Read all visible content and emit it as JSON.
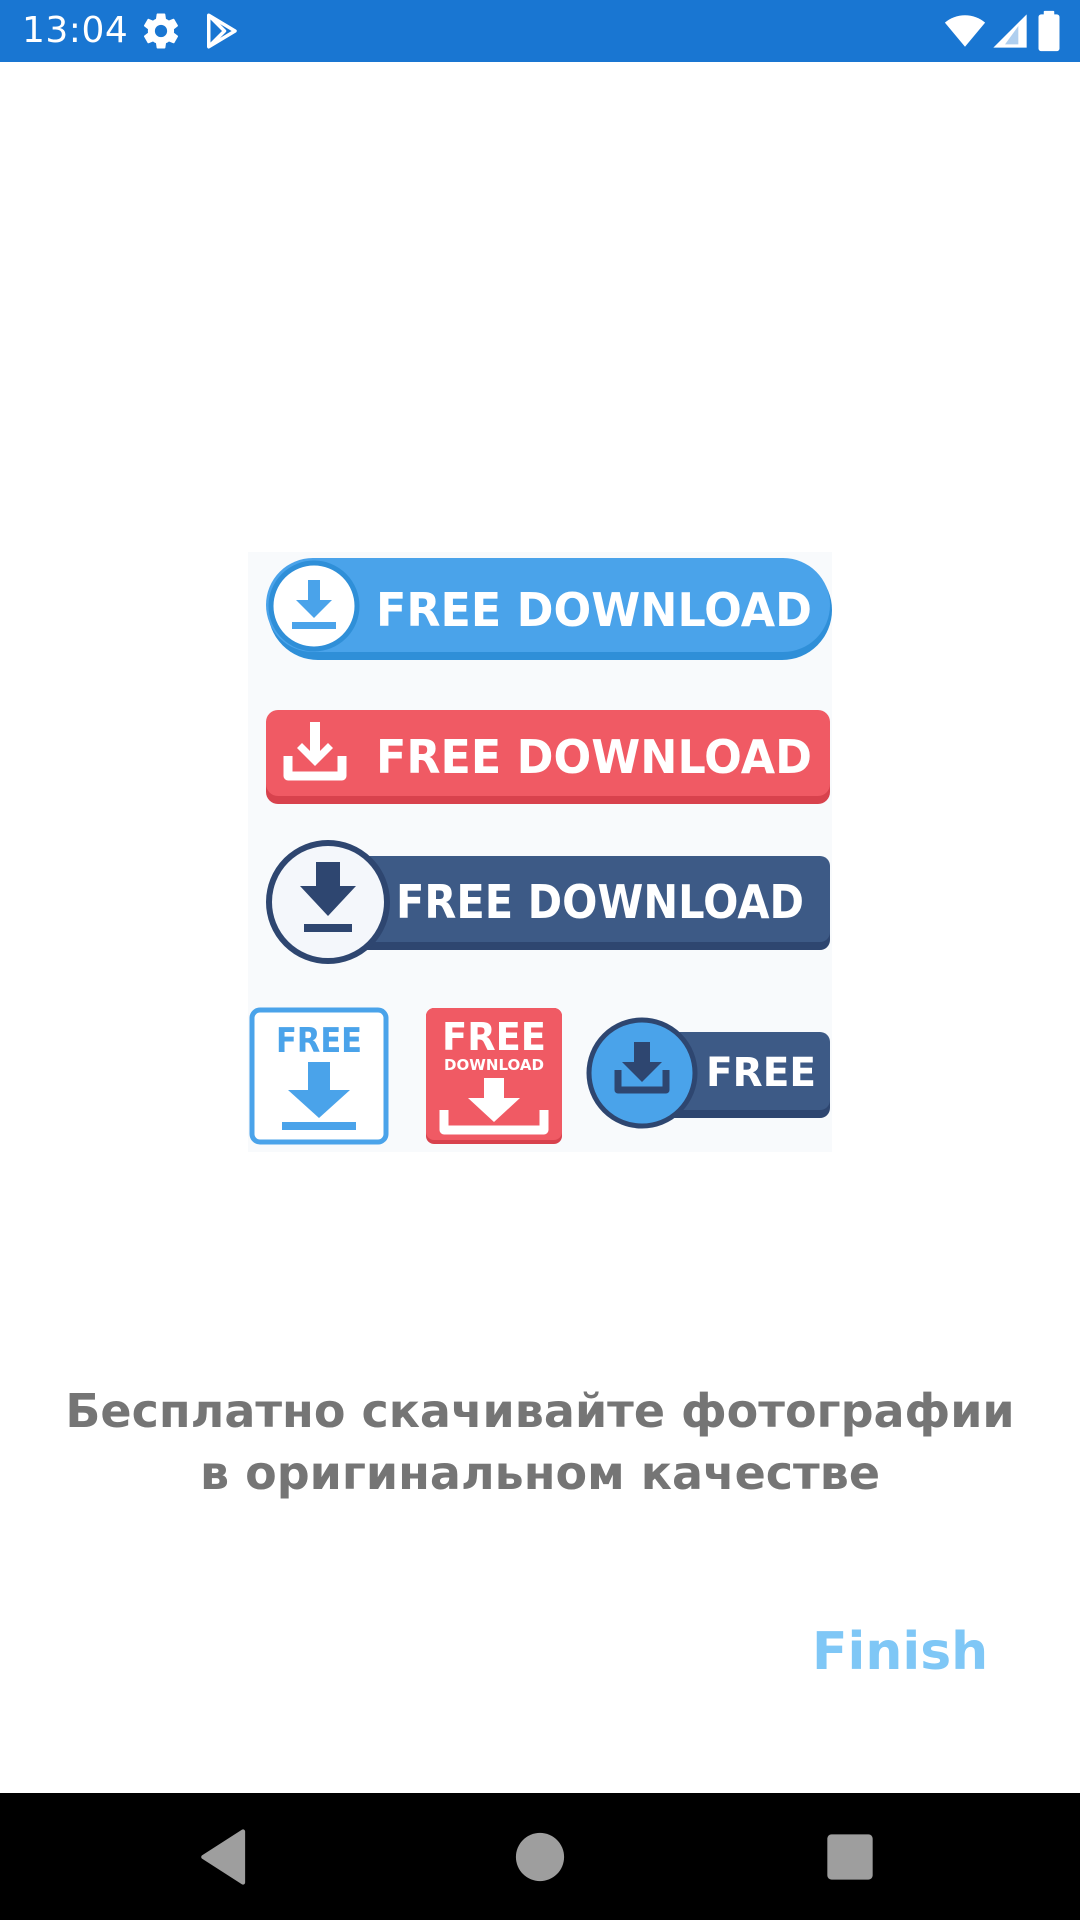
{
  "status_bar": {
    "time": "13:04",
    "background_color": "#1976d2",
    "icons": [
      "settings-icon",
      "play-store-icon",
      "wifi-icon",
      "signal-icon",
      "battery-icon"
    ]
  },
  "illustration": {
    "buttons": [
      {
        "label": "FREE DOWNLOAD",
        "color": "#4aa3ea",
        "style": "round-pill-with-circle-icon"
      },
      {
        "label": "FREE DOWNLOAD",
        "color": "#f05a64",
        "style": "flat-rectangle-with-tray-icon"
      },
      {
        "label": "FREE DOWNLOAD",
        "color": "#3d5a86",
        "style": "rectangle-with-outlined-circle-icon"
      }
    ],
    "badges": [
      {
        "label": "FREE",
        "color": "#4aa3ea",
        "style": "outlined-square"
      },
      {
        "label": "FREE",
        "sublabel": "DOWNLOAD",
        "color": "#f05a64",
        "style": "filled-square"
      },
      {
        "label": "FREE",
        "color": "#3d5a86",
        "style": "small-pill-with-circle-icon"
      }
    ]
  },
  "caption": "Бесплатно скачивайте фотографии в оригинальном качестве",
  "finish_label": "Finish",
  "finish_color": "#7fc7f6",
  "nav_bar": {
    "buttons": [
      "back-icon",
      "home-icon",
      "recents-icon"
    ]
  }
}
